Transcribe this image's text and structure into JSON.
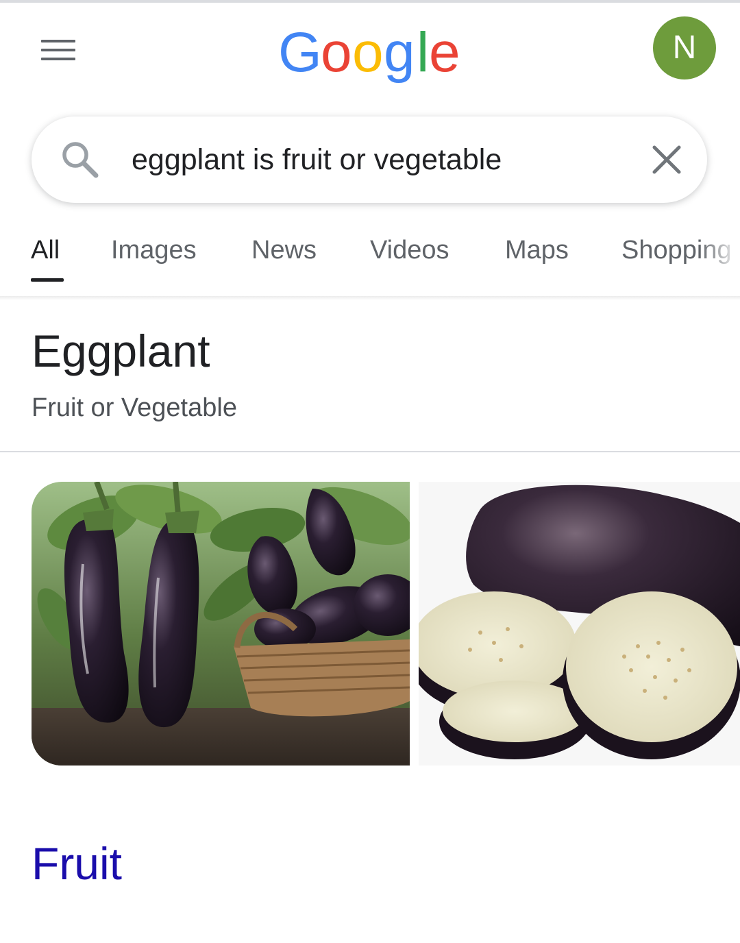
{
  "header": {
    "menu_icon": "hamburger-menu-icon",
    "logo": {
      "letters": [
        "G",
        "o",
        "o",
        "g",
        "l",
        "e"
      ],
      "colors": [
        "#4285F4",
        "#EA4335",
        "#FBBC05",
        "#4285F4",
        "#34A853",
        "#EA4335"
      ]
    },
    "avatar_initial": "N",
    "avatar_color": "#6e9c3c"
  },
  "search": {
    "query": "eggplant is fruit or vegetable",
    "search_icon": "search-icon",
    "clear_icon": "close-icon"
  },
  "tabs": [
    {
      "label": "All",
      "active": true
    },
    {
      "label": "Images",
      "active": false
    },
    {
      "label": "News",
      "active": false
    },
    {
      "label": "Videos",
      "active": false
    },
    {
      "label": "Maps",
      "active": false
    },
    {
      "label": "Shopping",
      "active": false
    }
  ],
  "knowledge_panel": {
    "title": "Eggplant",
    "subtitle": "Fruit or Vegetable",
    "images": [
      {
        "subject": "eggplants growing on plants with a wicker basket"
      },
      {
        "subject": "sliced eggplant rounds on white background"
      }
    ],
    "answer": "Fruit",
    "answer_color": "#1a0dab"
  }
}
